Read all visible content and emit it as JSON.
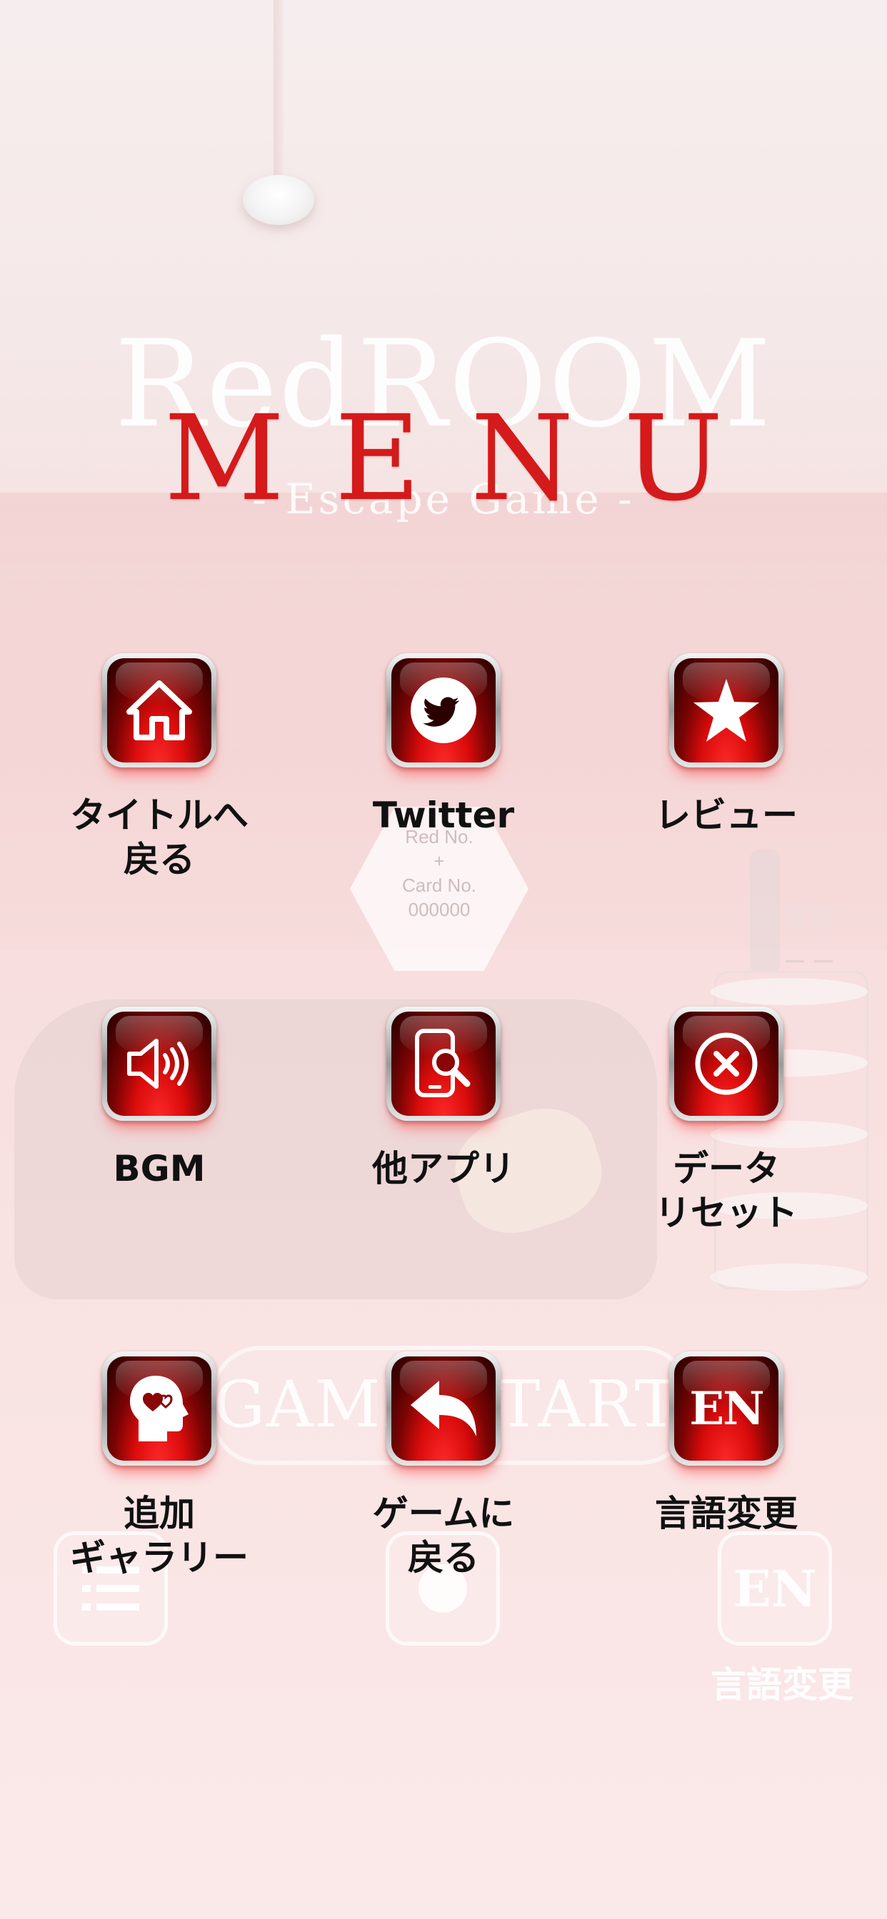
{
  "background": {
    "title": "RedROOM",
    "subtitle": "- Escape Game -",
    "hex_note_lines": [
      "Red No.",
      "+",
      "Card No.",
      "000000"
    ],
    "start_button": "GAME START",
    "corner_label": "言語変更",
    "corner_icon": "EN"
  },
  "menu": {
    "title": "MENU",
    "items": [
      {
        "label": "タイトルへ\n戻る",
        "icon": "home-icon"
      },
      {
        "label": "Twitter",
        "icon": "twitter-bird-icon"
      },
      {
        "label": "レビュー",
        "icon": "star-icon"
      },
      {
        "label": "BGM",
        "icon": "speaker-icon"
      },
      {
        "label": "他アプリ",
        "icon": "phone-search-icon"
      },
      {
        "label": "データ\nリセット",
        "icon": "x-circle-icon"
      },
      {
        "label": "追加\nギャラリー",
        "icon": "head-heart-icon"
      },
      {
        "label": "ゲームに\n戻る",
        "icon": "back-arrow-icon"
      },
      {
        "label": "言語変更",
        "icon": "EN"
      }
    ]
  },
  "colors": {
    "menu_title": "#d41a1a",
    "button_red": "#d90b0b",
    "label_text": "#111111"
  }
}
